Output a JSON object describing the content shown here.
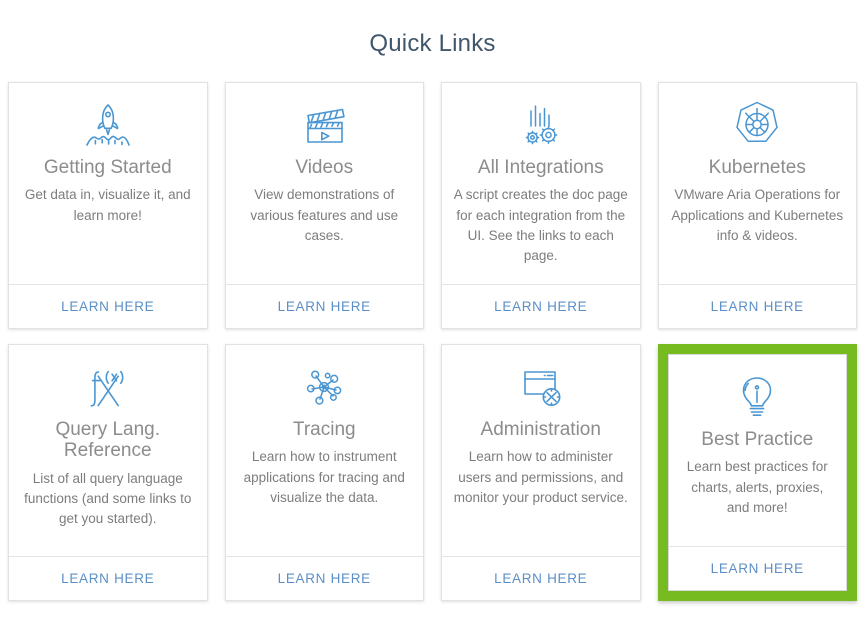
{
  "page": {
    "title": "Quick Links",
    "accent_blue": "#4a96d2",
    "link_blue": "#5b8fc7",
    "highlight_green": "#76bc21",
    "title_color": "#40576b"
  },
  "cards": [
    {
      "icon": "rocket-icon",
      "title": "Getting Started",
      "description": "Get data in, visualize it, and learn more!",
      "link_label": "LEARN HERE",
      "highlighted": false
    },
    {
      "icon": "video-clapperboard-icon",
      "title": "Videos",
      "description": "View demonstrations of various features and use cases.",
      "link_label": "LEARN HERE",
      "highlighted": false
    },
    {
      "icon": "gears-chart-icon",
      "title": "All Integrations",
      "description": "A script creates the doc page for each integration from the UI. See the links to each page.",
      "link_label": "LEARN HERE",
      "highlighted": false
    },
    {
      "icon": "kubernetes-icon",
      "title": "Kubernetes",
      "description": "VMware Aria Operations for Applications and Kubernetes info & videos.",
      "link_label": "LEARN HERE",
      "highlighted": false
    },
    {
      "icon": "function-fx-icon",
      "title": "Query Lang. Reference",
      "description": "List of all query language functions (and some links to get you started).",
      "link_label": "LEARN HERE",
      "highlighted": false
    },
    {
      "icon": "network-nodes-icon",
      "title": "Tracing",
      "description": "Learn how to instrument applications for tracing and visualize the data.",
      "link_label": "LEARN HERE",
      "highlighted": false
    },
    {
      "icon": "browser-settings-icon",
      "title": "Administration",
      "description": "Learn how to administer users and permissions, and monitor your product service.",
      "link_label": "LEARN HERE",
      "highlighted": false
    },
    {
      "icon": "lightbulb-info-icon",
      "title": "Best Practice",
      "description": "Learn best practices for charts, alerts, proxies, and more!",
      "link_label": "LEARN HERE",
      "highlighted": true
    }
  ]
}
